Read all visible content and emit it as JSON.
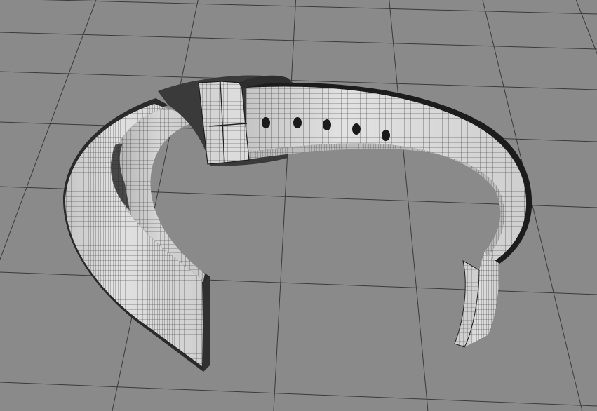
{
  "viewport": {
    "background_color": "#8a8a8a",
    "grid_line_color": "#3a3a3a",
    "display_mode": "wireframe-on-shaded"
  },
  "model": {
    "object": "watch-strap",
    "surface_color": "#d8d8d8",
    "shadow_color": "#b4b4b4",
    "edge_color": "#202020",
    "wire_color": "#1e1e1e",
    "strap_holes_visible": 5,
    "keeper_loops_visible": 2
  }
}
